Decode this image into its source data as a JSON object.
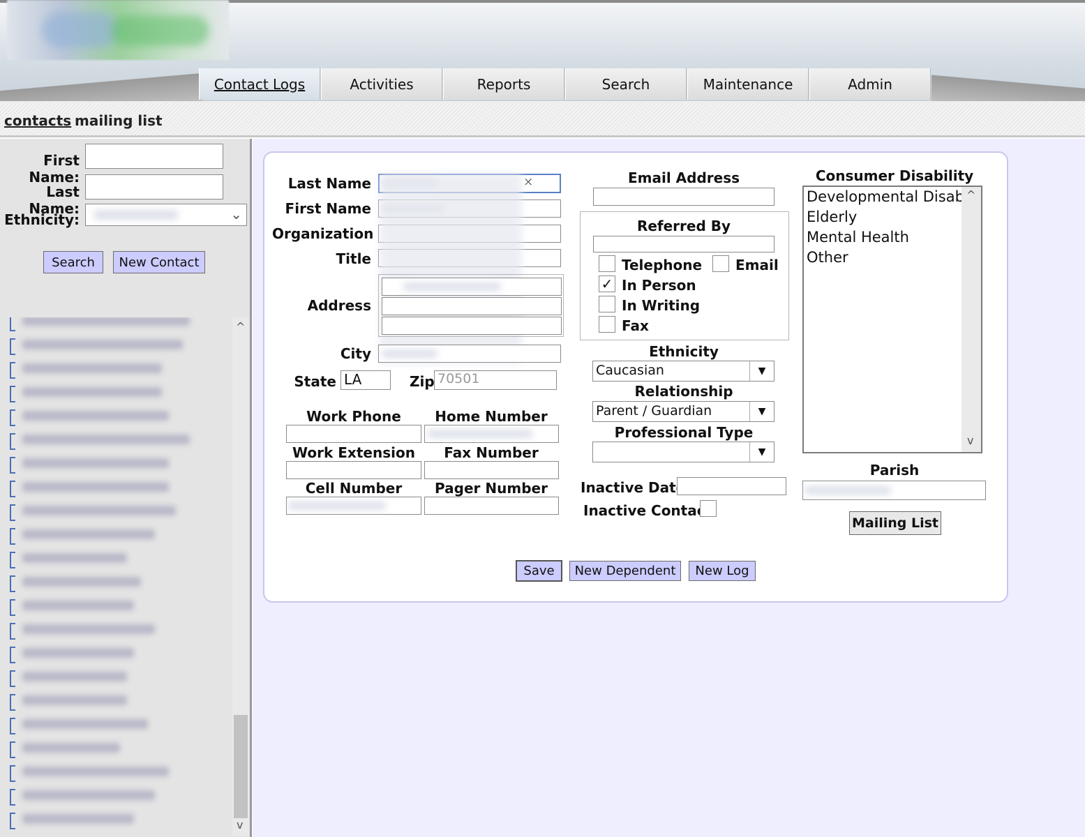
{
  "nav": {
    "tabs": [
      "Contact Logs",
      "Activities",
      "Reports",
      "Search",
      "Maintenance",
      "Admin"
    ],
    "subnav": [
      "contacts",
      "mailing list"
    ]
  },
  "left": {
    "first_name_label": "First Name:",
    "last_name_label": "Last Name:",
    "ethnicity_label": "Ethnicity:",
    "search_button": "Search",
    "new_contact_button": "New Contact"
  },
  "form": {
    "last_name_label": "Last Name",
    "last_name_clear": "×",
    "first_name_label": "First Name",
    "organization_label": "Organization",
    "title_label": "Title",
    "address_label": "Address",
    "city_label": "City",
    "state_label": "State",
    "state_value": "LA",
    "zip_label": "Zip",
    "zip_value": "70501",
    "work_phone_label": "Work Phone",
    "home_number_label": "Home Number",
    "work_extension_label": "Work Extension",
    "fax_number_label": "Fax Number",
    "cell_number_label": "Cell Number",
    "pager_number_label": "Pager Number",
    "email_label": "Email Address",
    "referred_by_label": "Referred By",
    "referral": {
      "telephone": "Telephone",
      "email": "Email",
      "in_person": "In Person",
      "in_writing": "In Writing",
      "fax": "Fax",
      "checked_mark": "✓"
    },
    "ethnicity_label": "Ethnicity",
    "ethnicity_value": "Caucasian",
    "relationship_label": "Relationship",
    "relationship_value": "Parent / Guardian",
    "professional_type_label": "Professional Type",
    "inactive_date_label": "Inactive Date",
    "inactive_contact_label": "Inactive Contact",
    "consumer_disability_label": "Consumer Disability",
    "disabilities": [
      "Developmental Disabi",
      "Elderly",
      "Mental Health",
      "Other"
    ],
    "parish_label": "Parish",
    "mailing_list_button": "Mailing List",
    "save_button": "Save",
    "new_dependent_button": "New Dependent",
    "new_log_button": "New Log"
  },
  "icons": {
    "dropdown": "▼",
    "chevron_up": "^",
    "chevron_down": "v"
  },
  "colors": {
    "button_bg": "#ccccff",
    "main_bg": "#eeeeff",
    "card_border": "#c7c7ee"
  }
}
